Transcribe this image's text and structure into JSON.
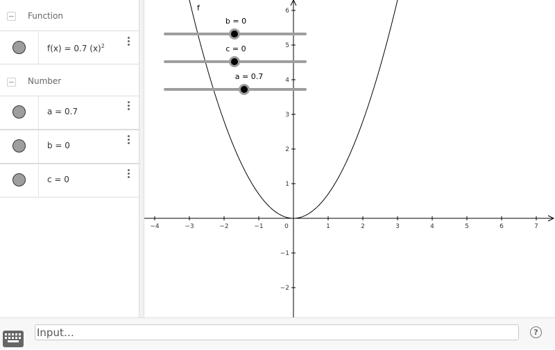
{
  "algebra": {
    "groups": [
      {
        "label": "Function",
        "rows": [
          {
            "prefix": "f(x) = 0.7 (x)",
            "exponent": "2"
          }
        ]
      },
      {
        "label": "Number",
        "rows": [
          {
            "text": "a = 0.7"
          },
          {
            "text": "b = 0"
          },
          {
            "text": "c = 0"
          }
        ]
      }
    ]
  },
  "graphics": {
    "function_label": "f",
    "x_ticks": [
      "−4",
      "−3",
      "−2",
      "−1",
      "0",
      "1",
      "2",
      "3",
      "4",
      "5",
      "6",
      "7"
    ],
    "y_ticks": [
      "−2",
      "−1",
      "1",
      "2",
      "3",
      "4",
      "5",
      "6"
    ],
    "sliders": [
      {
        "label": "b = 0",
        "value": 0
      },
      {
        "label": "c = 0",
        "value": 0
      },
      {
        "label": "a = 0.7",
        "value": 0.7
      }
    ]
  },
  "input_bar": {
    "placeholder": "Input…",
    "help": "?"
  },
  "colors": {
    "marble": "#9e9e9e",
    "slider_track": "#9e9e9e",
    "slider_knob": "#000000",
    "curve": "#000000"
  }
}
